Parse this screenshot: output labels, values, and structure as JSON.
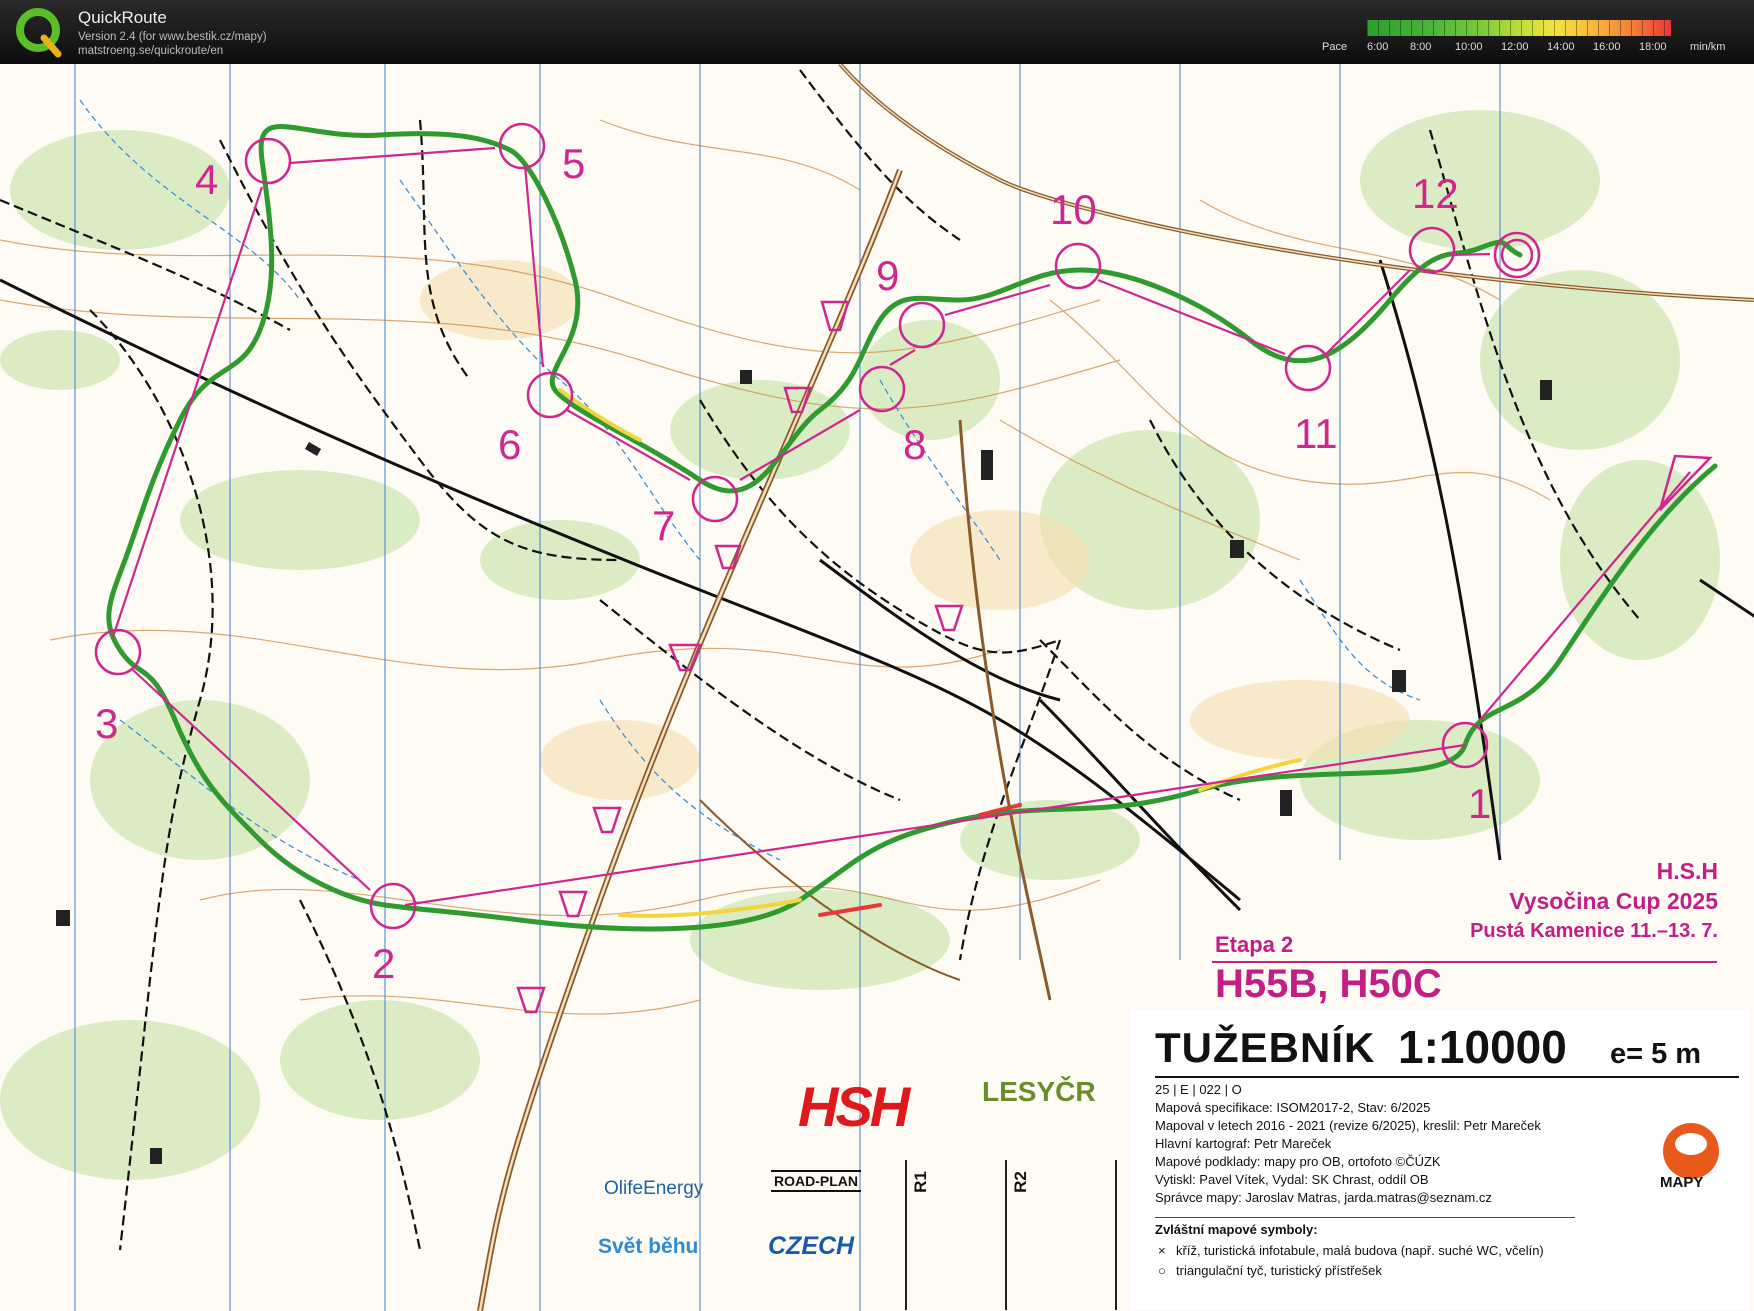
{
  "app": {
    "title": "QuickRoute",
    "version_line": "Version 2.4  (for www.bestik.cz/mapy)",
    "url_line": "matstroeng.se/quickroute/en",
    "logo_letter": "Q"
  },
  "pace_scale": {
    "label": "Pace",
    "ticks": [
      "6:00",
      "8:00",
      "10:00",
      "12:00",
      "14:00",
      "16:00",
      "18:00"
    ],
    "unit": "min/km",
    "colors": [
      "#2ca02c",
      "#7ccb3a",
      "#f4e23c",
      "#f57a3a",
      "#e8373a"
    ]
  },
  "map": {
    "controls": [
      "1",
      "2",
      "3",
      "4",
      "5",
      "6",
      "7",
      "8",
      "9",
      "10",
      "11",
      "12"
    ],
    "course_color": "#d0278f"
  },
  "legend": {
    "club": "H.S.H",
    "event": "Vysočina Cup 2025",
    "place_dates": "Pustá Kamenice  11.–13. 7.",
    "stage": "Etapa 2",
    "categories": "H55B, H50C",
    "map_name": "TUŽEBNÍK",
    "scale": "1:10000",
    "equidistance": "e= 5 m",
    "info_lines": [
      "25 | E | 022 | O",
      "Mapová specifikace: ISOM2017-2, Stav: 6/2025",
      "Mapoval v letech 2016 - 2021 (revize 6/2025), kreslil: Petr Mareček",
      "Hlavní kartograf: Petr Mareček",
      "Mapové podklady: mapy pro OB, ortofoto ©ČÚZK",
      "Vytiskl: Pavel Vítek, Vydal: SK Chrast, oddíl OB",
      "Správce mapy: Jaroslav Matras, jarda.matras@seznam.cz"
    ],
    "special_symbols_title": "Zvláštní mapové symboly:",
    "special_symbols": [
      {
        "mark": "×",
        "text": "kříž, turistická infotabule, malá budova (např. suché WC, včelín)"
      },
      {
        "mark": "○",
        "text": "triangulační tyč, turistický přístřešek"
      }
    ],
    "r1": "R1",
    "r2": "R2"
  },
  "sponsors": {
    "hsh": "HSH",
    "lesy": "LESYČR",
    "olife": "OlifeEnergy",
    "roadplan": "ROAD-PLAN",
    "svet": "Svět běhu",
    "czech": "CZECH",
    "mapy": "MAPY"
  }
}
